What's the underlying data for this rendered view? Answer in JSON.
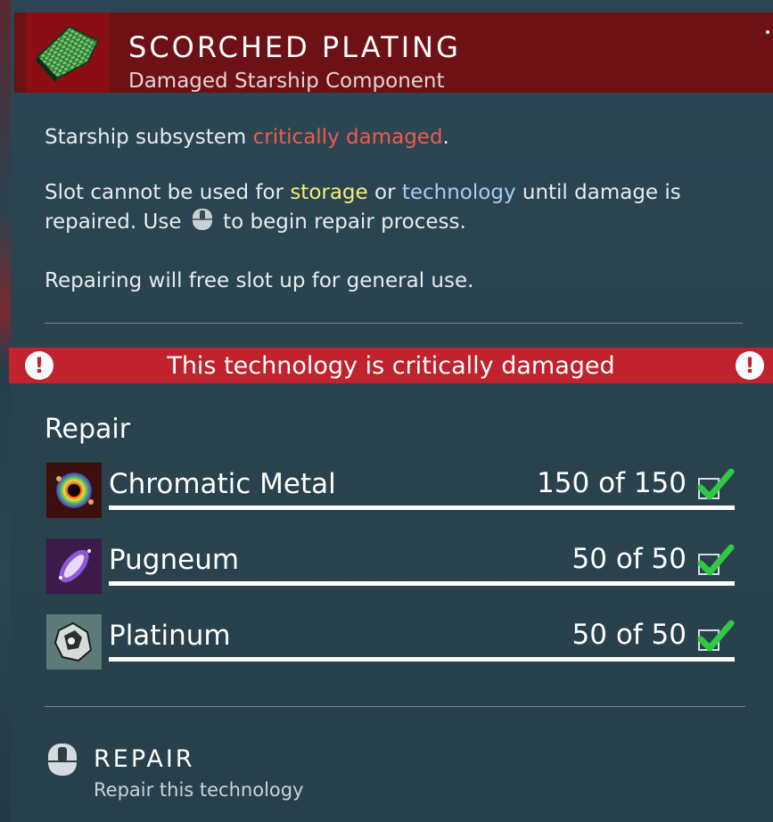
{
  "header": {
    "title": "SCORCHED PLATING",
    "subtitle": "Damaged Starship Component",
    "icon": "scorched-plating-icon"
  },
  "description": {
    "line1_prefix": "Starship subsystem ",
    "line1_highlight": "critically damaged",
    "line1_suffix": ".",
    "line2_prefix": "Slot cannot be used for ",
    "line2_storage": "storage",
    "line2_or": " or ",
    "line2_technology": "technology",
    "line2_mid": " until damage is repaired. Use ",
    "line2_suffix": " to begin repair process.",
    "line3": "Repairing will free slot up for general use."
  },
  "warning": {
    "text": "This technology is critically damaged",
    "icon": "exclamation-icon"
  },
  "repair": {
    "heading": "Repair",
    "requirements": [
      {
        "name": "Chromatic Metal",
        "count": "150 of 150",
        "icon": "chromatic-metal-icon",
        "fulfilled": 1.0
      },
      {
        "name": "Pugneum",
        "count": "50 of 50",
        "icon": "pugneum-icon",
        "fulfilled": 1.0
      },
      {
        "name": "Platinum",
        "count": "50 of 50",
        "icon": "platinum-icon",
        "fulfilled": 1.0
      }
    ]
  },
  "action": {
    "label": "REPAIR",
    "sublabel": "Repair this technology",
    "icon": "mouse-icon"
  },
  "colors": {
    "header_bg": "#6e1116",
    "warning_bg": "#c0232d",
    "critical_text": "#ef5a4c",
    "storage_text": "#f3ef7a",
    "technology_text": "#a8cdf3",
    "check_green": "#2fc944"
  }
}
